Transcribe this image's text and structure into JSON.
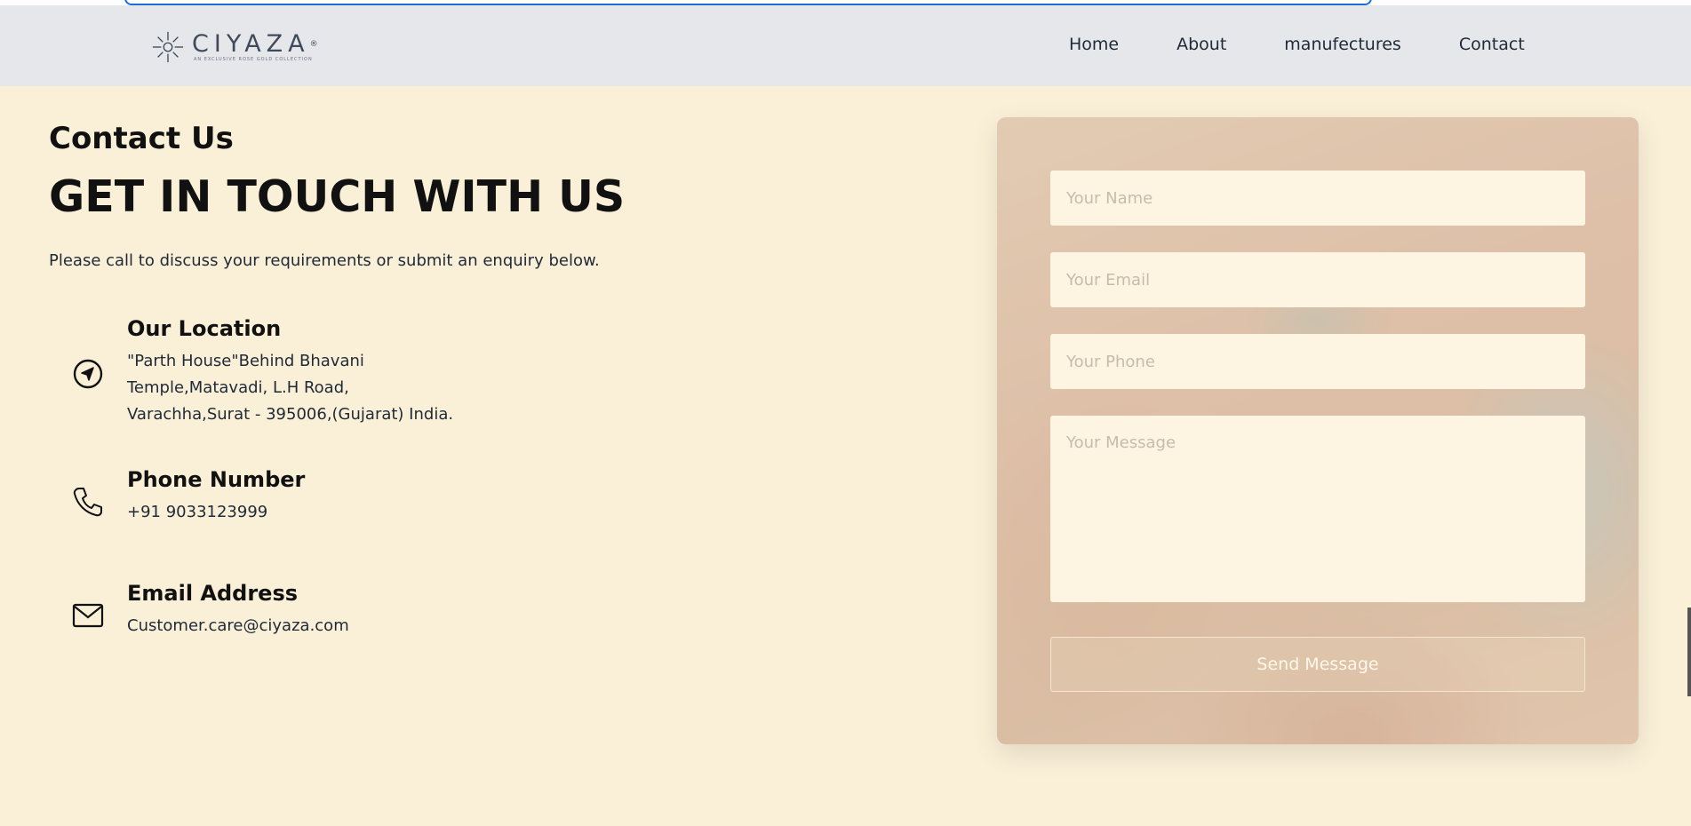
{
  "header": {
    "logo_text": "CIYAZA",
    "logo_reg": "®",
    "logo_tagline": "AN EXCLUSIVE ROSE GOLD COLLECTION",
    "nav": [
      "Home",
      "About",
      "manufectures",
      "Contact"
    ]
  },
  "intro": {
    "kicker": "Contact Us",
    "headline": "GET IN TOUCH WITH US",
    "description": "Please call to discuss your requirements or submit an enquiry below."
  },
  "info": {
    "location_title": "Our Location",
    "location_line1": "\"Parth House\"Behind Bhavani",
    "location_line2": "Temple,Matavadi, L.H Road,",
    "location_line3": "Varachha,Surat - 395006,(Gujarat) India.",
    "phone_title": "Phone Number",
    "phone_value": "+91 9033123999",
    "email_title": "Email Address",
    "email_value": "Customer.care@ciyaza.com"
  },
  "form": {
    "name_placeholder": "Your Name",
    "email_placeholder": "Your Email",
    "phone_placeholder": "Your Phone",
    "message_placeholder": "Your Message",
    "send_label": "Send Message"
  },
  "icons": {
    "location": "navigation-arrow-icon",
    "phone": "phone-icon",
    "email": "envelope-icon",
    "logo": "sun-star-icon"
  },
  "colors": {
    "page_bg": "#faefd7",
    "header_bg": "#e5e7eb",
    "field_bg": "#fdf5e2"
  }
}
